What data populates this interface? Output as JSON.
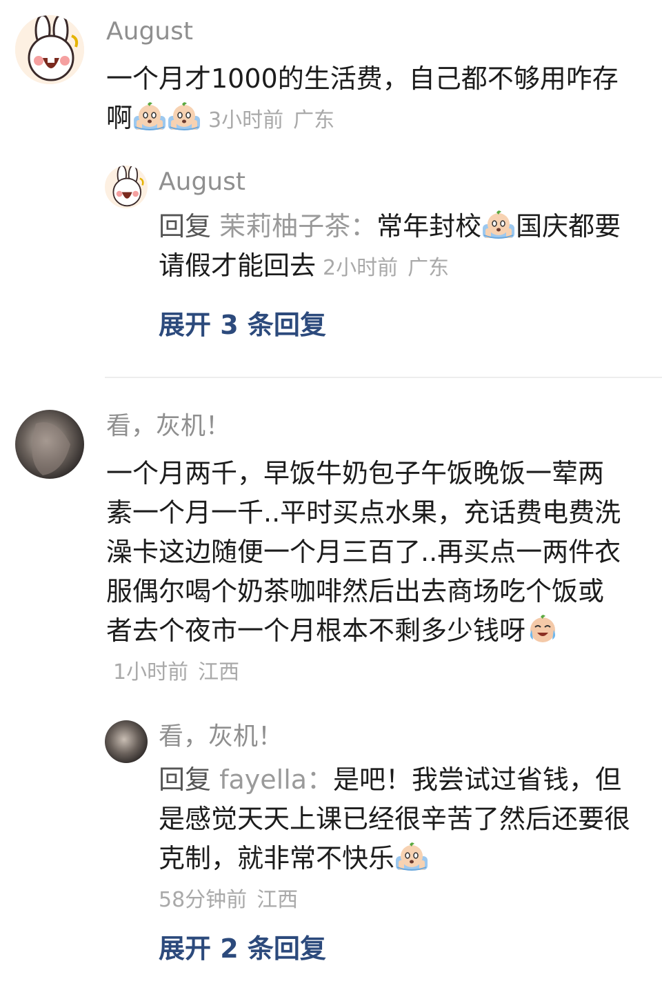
{
  "comments": [
    {
      "author": "August",
      "text": "一个月才1000的生活费，自己都不够用咋存啊",
      "emojis": [
        "crying-emoji",
        "crying-emoji"
      ],
      "time": "3小时前",
      "location": "广东",
      "reply": {
        "author": "August",
        "reply_prefix": "回复",
        "reply_to": "茉莉柚子茶：",
        "text_before_emoji": "常年封校",
        "emoji": "crying-emoji",
        "text_after_emoji": "国庆都要请假才能回去",
        "time": "2小时前",
        "location": "广东"
      },
      "expand_label": "展开 3 条回复"
    },
    {
      "author": "看，灰机！",
      "text": "一个月两千，早饭牛奶包子午饭晚饭一荤两素一个月一千..平时买点水果，充话费电费洗澡卡这边随便一个月三百了..再买点一两件衣服偶尔喝个奶茶咖啡然后出去商场吃个饭或者去个夜市一个月根本不剩多少钱呀",
      "emojis": [
        "laugh-cry-emoji"
      ],
      "time": "1小时前",
      "location": "江西",
      "reply": {
        "author": "看，灰机！",
        "reply_prefix": "回复",
        "reply_to": "fayella：",
        "text": "是吧！我尝试过省钱，但是感觉天天上课已经很辛苦了然后还要很克制，就非常不快乐",
        "emoji": "crying-emoji",
        "time": "58分钟前",
        "location": "江西"
      },
      "expand_label": "展开 2 条回复"
    }
  ],
  "colors": {
    "name_gray": "#8f8f8f",
    "meta_gray": "#a9a9a9",
    "expand_blue": "#2c4a7c",
    "divider": "#ededed"
  }
}
